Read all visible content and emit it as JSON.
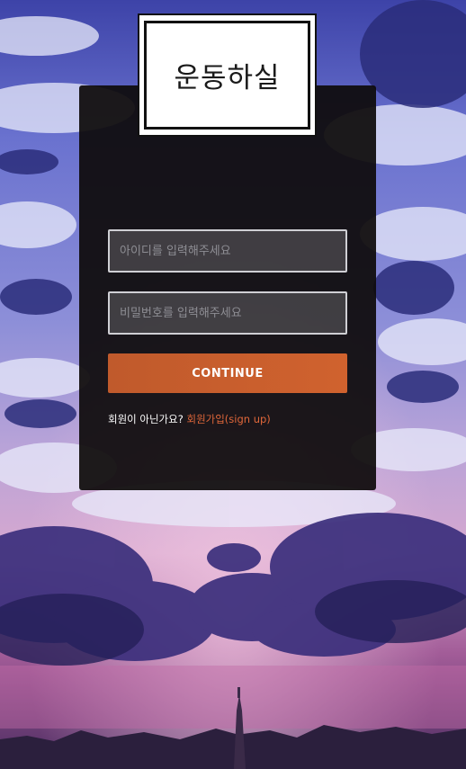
{
  "brand": {
    "logo_text": "운동하실"
  },
  "login": {
    "id_placeholder": "아이디를 입력해주세요",
    "password_placeholder": "비밀번호를 입력해주세요",
    "continue_label": "CONTINUE",
    "signup_prompt": "회원이 아닌가요?",
    "signup_link": "회원가입(sign up)"
  },
  "colors": {
    "panel": "#0e0b0b",
    "button": "#c9602f",
    "link": "#e0673a"
  }
}
